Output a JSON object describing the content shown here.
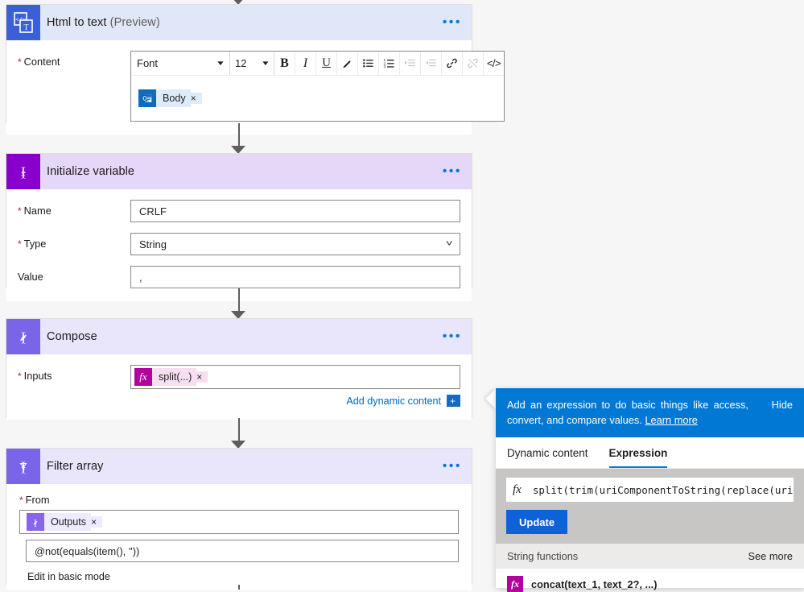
{
  "canvas": {
    "cards": [
      {
        "id": "html-to-text",
        "title": "Html to text",
        "title_suffix": "(Preview)",
        "icon": "html-to-text-icon",
        "header_color": "#dfe7f9",
        "icon_color": "#3b5fd6",
        "menu": "•••",
        "field_label": "Content",
        "required": true,
        "editor": {
          "font_name": "Font",
          "font_size": "12",
          "buttons": [
            "B",
            "I",
            "U",
            "highlight-icon",
            "bulleted-list-icon",
            "numbered-list-icon",
            "increase-indent-icon",
            "decrease-indent-icon",
            "link-icon",
            "unlink-icon",
            "code-view-icon"
          ],
          "token": {
            "label": "Body",
            "icon": "outlook-icon",
            "remove": "×"
          }
        }
      },
      {
        "id": "initialize-variable",
        "title": "Initialize variable",
        "title_suffix": "",
        "icon": "variable-braces-icon",
        "header_color": "#e5d7f7",
        "icon_color": "#8800cc",
        "menu": "•••",
        "fields": [
          {
            "label": "Name",
            "required": true,
            "value": "CRLF",
            "type": "text"
          },
          {
            "label": "Type",
            "required": true,
            "value": "String",
            "type": "dropdown"
          },
          {
            "label": "Value",
            "required": false,
            "value": ",",
            "type": "text"
          }
        ]
      },
      {
        "id": "compose",
        "title": "Compose",
        "title_suffix": "",
        "icon": "compose-pencil-braces-icon",
        "header_color": "#e9e5fb",
        "icon_color": "#7a64e8",
        "menu": "•••",
        "field_label": "Inputs",
        "required": true,
        "token": {
          "label": "split(...)",
          "icon": "fx-icon",
          "remove": "×"
        },
        "add_dynamic_content": "Add dynamic content",
        "add_dynamic_plus": "+"
      },
      {
        "id": "filter-array",
        "title": "Filter array",
        "title_suffix": "",
        "icon": "filter-funnel-braces-icon",
        "header_color": "#e9e5fb",
        "icon_color": "#7a64e8",
        "menu": "•••",
        "from_label": "From",
        "from_required": true,
        "from_token": {
          "label": "Outputs",
          "icon": "compose-braces-icon",
          "remove": "×"
        },
        "condition": "@not(equals(item(), ''))",
        "basic_mode_link": "Edit in basic mode"
      }
    ]
  },
  "expression_panel": {
    "tip_text": "Add an expression to do basic things like access, convert, and compare values. ",
    "tip_link": "Learn more",
    "hide_label": "Hide",
    "tabs": [
      {
        "label": "Dynamic content",
        "active": false
      },
      {
        "label": "Expression",
        "active": true
      }
    ],
    "fx_glyph": "fx",
    "expression_value": "split(trim(uriComponentToString(replace(uriC",
    "update_button": "Update",
    "functions_header": "String functions",
    "see_more": "See more",
    "functions": [
      {
        "name": "concat(text_1, text_2?, ...)",
        "icon": "fx-icon"
      }
    ]
  },
  "colors": {
    "accent_blue": "#0078d4",
    "link_blue": "#0067b8",
    "required_red": "#a4262c",
    "purple": "#8800cc",
    "violet": "#7a64e8",
    "magenta": "#b4009e"
  }
}
